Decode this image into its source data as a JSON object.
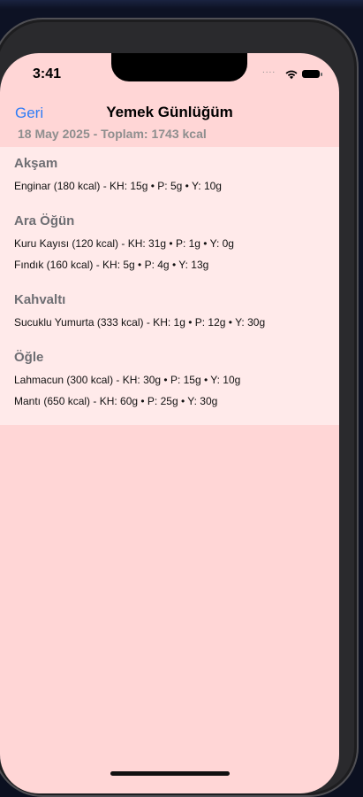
{
  "status_bar": {
    "time": "3:41",
    "signal": "....",
    "wifi_icon": "wifi-icon",
    "battery_icon": "battery-icon"
  },
  "nav": {
    "back_label": "Geri",
    "title": "Yemek Günlüğüm",
    "subtitle": "18 May 2025 - Toplam: 1743 kcal"
  },
  "sections": [
    {
      "title": "Akşam",
      "items": [
        "Enginar (180 kcal) - KH: 15g • P: 5g • Y: 10g"
      ]
    },
    {
      "title": "Ara Öğün",
      "items": [
        "Kuru Kayısı (120 kcal) - KH: 31g • P: 1g • Y: 0g",
        "Fındık (160 kcal) - KH: 5g • P: 4g • Y: 13g"
      ]
    },
    {
      "title": "Kahvaltı",
      "items": [
        "Sucuklu Yumurta (333 kcal) - KH: 1g • P: 12g • Y: 30g"
      ]
    },
    {
      "title": "Öğle",
      "items": [
        "Lahmacun (300 kcal) - KH: 30g • P: 15g • Y: 10g",
        "Mantı (650 kcal) - KH: 60g • P: 25g • Y: 30g"
      ]
    }
  ],
  "colors": {
    "screen_background": "#ffd6d6",
    "list_background": "#ffeaea",
    "accent": "#2f7cf6",
    "section_title": "#6e6e73",
    "subtitle": "#8e8e8e"
  }
}
